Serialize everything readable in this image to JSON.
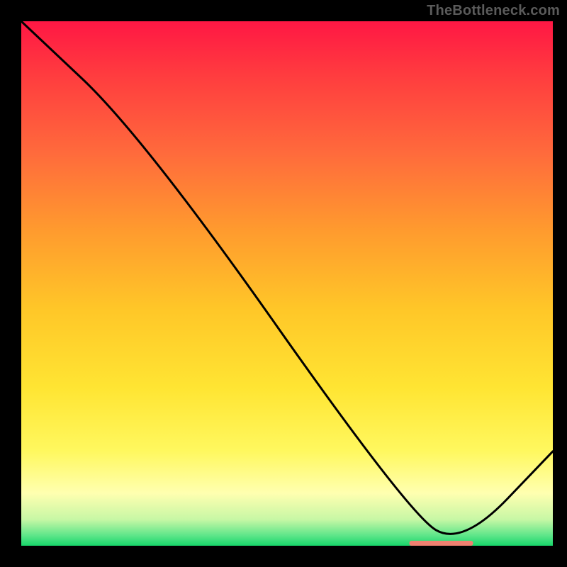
{
  "watermark": "TheBottleneck.com",
  "chart_data": {
    "type": "line",
    "title": "",
    "xlabel": "",
    "ylabel": "",
    "xlim": [
      0,
      100
    ],
    "ylim": [
      0,
      100
    ],
    "grid": false,
    "legend": false,
    "series": [
      {
        "name": "curve",
        "x": [
          0,
          23,
          73,
          83,
          100
        ],
        "values": [
          100,
          78,
          6,
          0,
          18
        ]
      }
    ],
    "marker": {
      "x_start": 73,
      "x_end": 85,
      "y": 0,
      "color": "#f08070"
    },
    "gradient_stops": [
      {
        "offset": 0.0,
        "color": "#ff1744"
      },
      {
        "offset": 0.1,
        "color": "#ff3b3f"
      },
      {
        "offset": 0.25,
        "color": "#ff6a3c"
      },
      {
        "offset": 0.4,
        "color": "#ff9b2e"
      },
      {
        "offset": 0.55,
        "color": "#ffc728"
      },
      {
        "offset": 0.7,
        "color": "#ffe533"
      },
      {
        "offset": 0.82,
        "color": "#fff85f"
      },
      {
        "offset": 0.9,
        "color": "#ffffb0"
      },
      {
        "offset": 0.95,
        "color": "#c7f7a5"
      },
      {
        "offset": 0.98,
        "color": "#5fe68a"
      },
      {
        "offset": 1.0,
        "color": "#18d66b"
      }
    ]
  }
}
